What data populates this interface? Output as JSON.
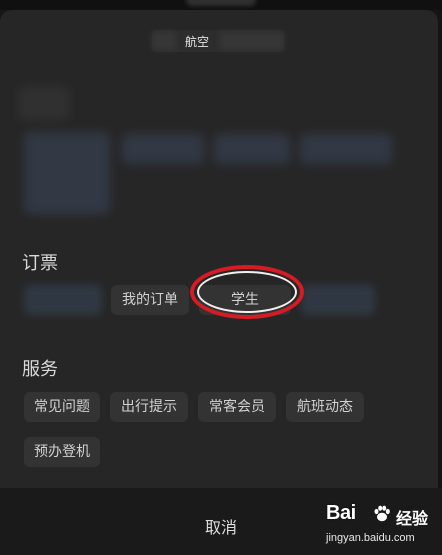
{
  "header": {
    "title": "航空"
  },
  "booking": {
    "label": "订票",
    "chips": [
      "我的订单",
      "学生"
    ]
  },
  "services": {
    "label": "服务",
    "chips": [
      "常见问题",
      "出行提示",
      "常客会员",
      "航班动态",
      "预办登机"
    ]
  },
  "footer": {
    "cancel_label": "取消"
  },
  "watermark": {
    "logo": "Bai",
    "logo_icon": "paw-icon",
    "text": "经验",
    "url": "jingyan.baidu.com"
  },
  "colors": {
    "background": "#161616",
    "sheet": "#262626",
    "chip": "#333333",
    "text": "#d2d2d2",
    "annotation": "#d61b24"
  }
}
